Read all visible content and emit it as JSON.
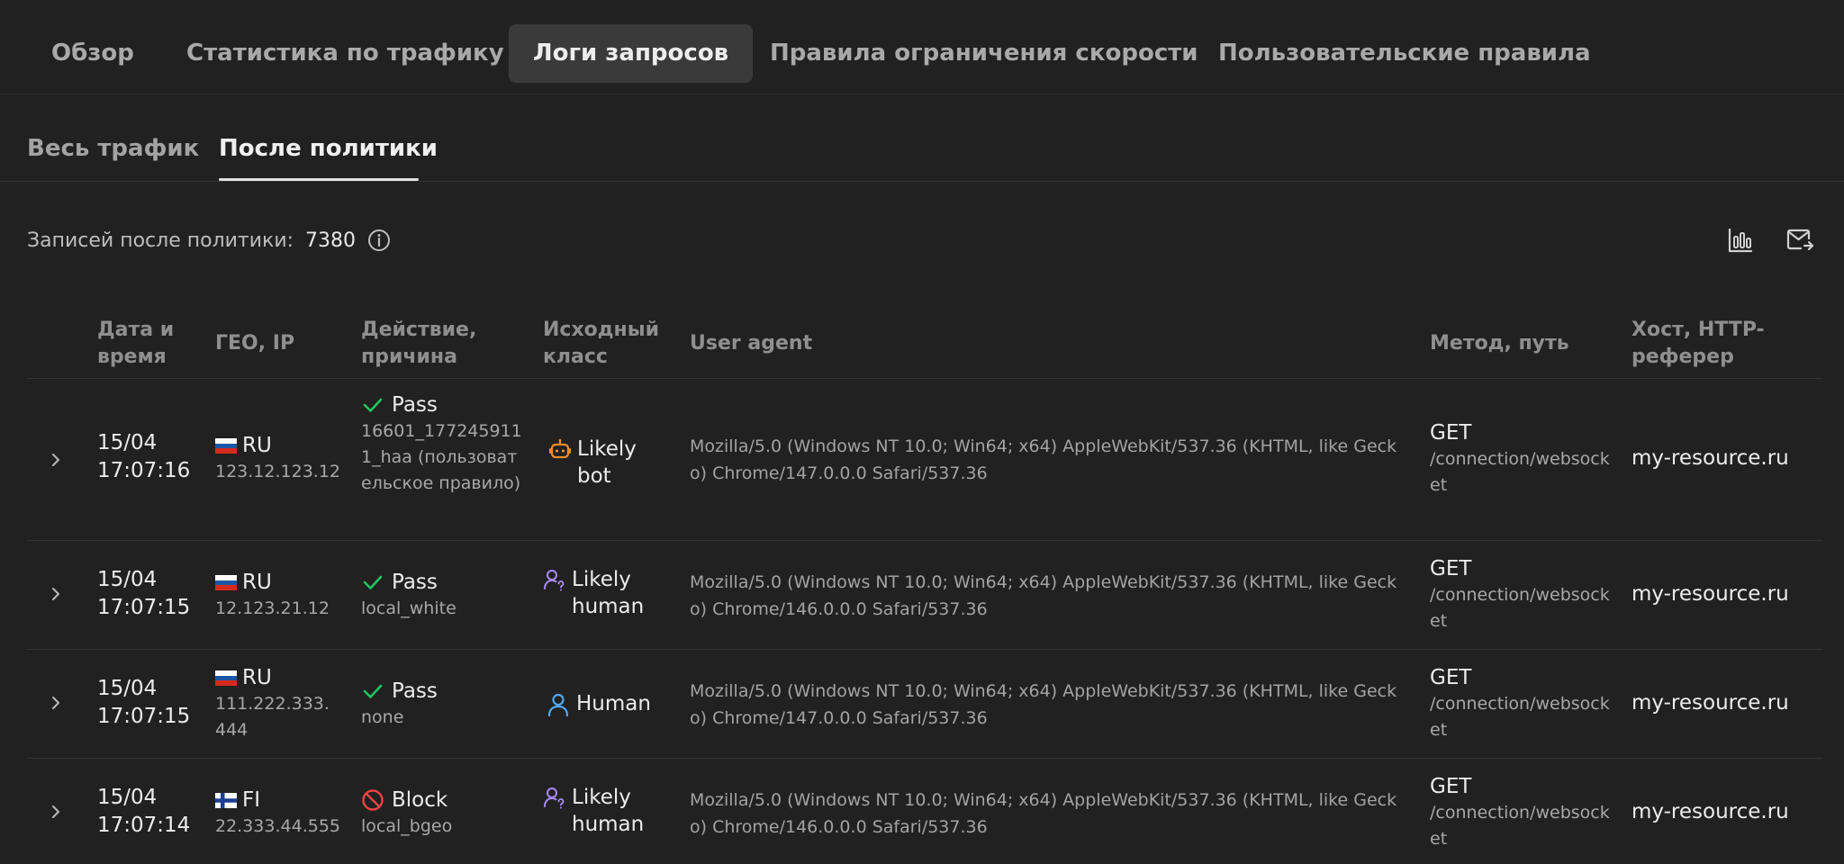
{
  "nav": {
    "tabs": [
      {
        "label": "Обзор"
      },
      {
        "label": "Статистика по трафику"
      },
      {
        "label": "Логи запросов"
      },
      {
        "label": "Правила ограничения скорости"
      },
      {
        "label": "Пользовательские правила"
      }
    ],
    "active_tab": "Логи запросов"
  },
  "subtabs": {
    "items": [
      {
        "label": "Весь трафик"
      },
      {
        "label": "После политики"
      }
    ],
    "active": "После политики"
  },
  "records": {
    "label": "Записей после политики:",
    "count": "7380"
  },
  "table": {
    "columns": [
      "Дата и время",
      "ГЕО, IP",
      "Действие, причина",
      "Исходный класс",
      "User agent",
      "Метод, путь",
      "Хост, HTTP-реферер"
    ],
    "rows": [
      {
        "date": "15/04",
        "time": "17:07:16",
        "country": "RU",
        "flag": "ru",
        "ip": "123.12.123.12",
        "action": "Pass",
        "action_icon": "check-icon",
        "reason": "16601_1772459111_haa (пользовательское правило)",
        "class": "Likely bot",
        "class_icon": "bot-icon",
        "user_agent": "Mozilla/5.0 (Windows NT 10.0; Win64; x64) AppleWebKit/537.36 (KHTML, like Gecko) Chrome/147.0.0.0 Safari/537.36",
        "method": "GET",
        "path": "/connection/websocket",
        "host": "my-resource.ru"
      },
      {
        "date": "15/04",
        "time": "17:07:15",
        "country": "RU",
        "flag": "ru",
        "ip": "12.123.21.12",
        "action": "Pass",
        "action_icon": "check-icon",
        "reason": "local_white",
        "class": "Likely human",
        "class_icon": "likely-human-icon",
        "user_agent": "Mozilla/5.0 (Windows NT 10.0; Win64; x64) AppleWebKit/537.36 (KHTML, like Gecko) Chrome/146.0.0.0 Safari/537.36",
        "method": "GET",
        "path": "/connection/websocket",
        "host": "my-resource.ru"
      },
      {
        "date": "15/04",
        "time": "17:07:15",
        "country": "RU",
        "flag": "ru",
        "ip": "111.222.333.444",
        "action": "Pass",
        "action_icon": "check-icon",
        "reason": "none",
        "class": "Human",
        "class_icon": "human-icon",
        "user_agent": "Mozilla/5.0 (Windows NT 10.0; Win64; x64) AppleWebKit/537.36 (KHTML, like Gecko) Chrome/147.0.0.0 Safari/537.36",
        "method": "GET",
        "path": "/connection/websocket",
        "host": "my-resource.ru"
      },
      {
        "date": "15/04",
        "time": "17:07:14",
        "country": "FI",
        "flag": "fi",
        "ip": "22.333.44.555",
        "action": "Block",
        "action_icon": "block-icon",
        "reason": "local_bgeo",
        "class": "Likely human",
        "class_icon": "likely-human-icon",
        "user_agent": "Mozilla/5.0 (Windows NT 10.0; Win64; x64) AppleWebKit/537.36 (KHTML, like Gecko) Chrome/146.0.0.0 Safari/537.36",
        "method": "GET",
        "path": "/connection/websocket",
        "host": "my-resource.ru"
      }
    ]
  },
  "colors": {
    "background": "#212121",
    "pass": "#22c55e",
    "block": "#ef4444",
    "bot": "#f28c28",
    "likely_human": "#a78bfa",
    "human": "#4ea8f5"
  }
}
